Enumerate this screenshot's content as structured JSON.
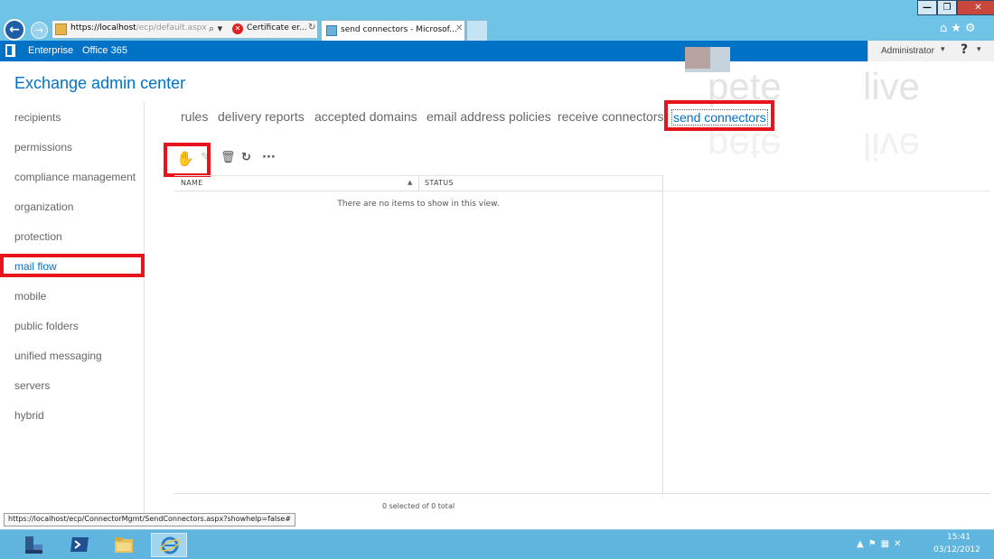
{
  "browser": {
    "address_host": "https://localhost",
    "address_path": "/ecp/default.aspx",
    "search_glyph": "⌕ ▾",
    "certificate_text": "Certificate er...",
    "refresh_glyph": "↻",
    "tab_title": "send connectors - Microsof...",
    "tab_close": "✕",
    "back_glyph": "←",
    "forward_glyph": "→",
    "window_min": "—",
    "window_max": "❐",
    "window_close": "✕",
    "chrome_icons": "⌂★⚙"
  },
  "o365": {
    "enterprise": "Enterprise",
    "office365": "Office 365",
    "user": "Administrator",
    "caret": "▾",
    "help": "?"
  },
  "watermark": {
    "word1": "pete",
    "word2": "live"
  },
  "app": {
    "title": "Exchange admin center"
  },
  "nav": {
    "items": [
      {
        "label": "recipients"
      },
      {
        "label": "permissions"
      },
      {
        "label": "compliance management"
      },
      {
        "label": "organization"
      },
      {
        "label": "protection"
      },
      {
        "label": "mail flow"
      },
      {
        "label": "mobile"
      },
      {
        "label": "public folders"
      },
      {
        "label": "unified messaging"
      },
      {
        "label": "servers"
      },
      {
        "label": "hybrid"
      }
    ],
    "active": "mail flow"
  },
  "tabs": [
    {
      "label": "rules"
    },
    {
      "label": "delivery reports"
    },
    {
      "label": "accepted domains"
    },
    {
      "label": "email address policies"
    },
    {
      "label": "receive connectors"
    },
    {
      "label": "send connectors"
    }
  ],
  "toolbar": {
    "add_icon": "✋",
    "edit_icon": "✎",
    "delete_icon": "🗑",
    "refresh_icon": "↻",
    "more_icon": "···"
  },
  "grid": {
    "columns": [
      "NAME",
      "STATUS"
    ],
    "sort_indicator": "▲",
    "empty_message": "There are no items to show in this view.",
    "footer": "0 selected of 0 total"
  },
  "status_url": "https://localhost/ecp/ConnectorMgmt/SendConnectors.aspx?showhelp=false#",
  "taskbar": {
    "tray_icons": "▲⚑▦✕",
    "time": "15:41",
    "date": "03/12/2012"
  },
  "colors": {
    "accent": "#0072c6",
    "highlight": "#e8141b",
    "chrome": "#6fc3e6",
    "taskbar": "#5fb5de"
  }
}
